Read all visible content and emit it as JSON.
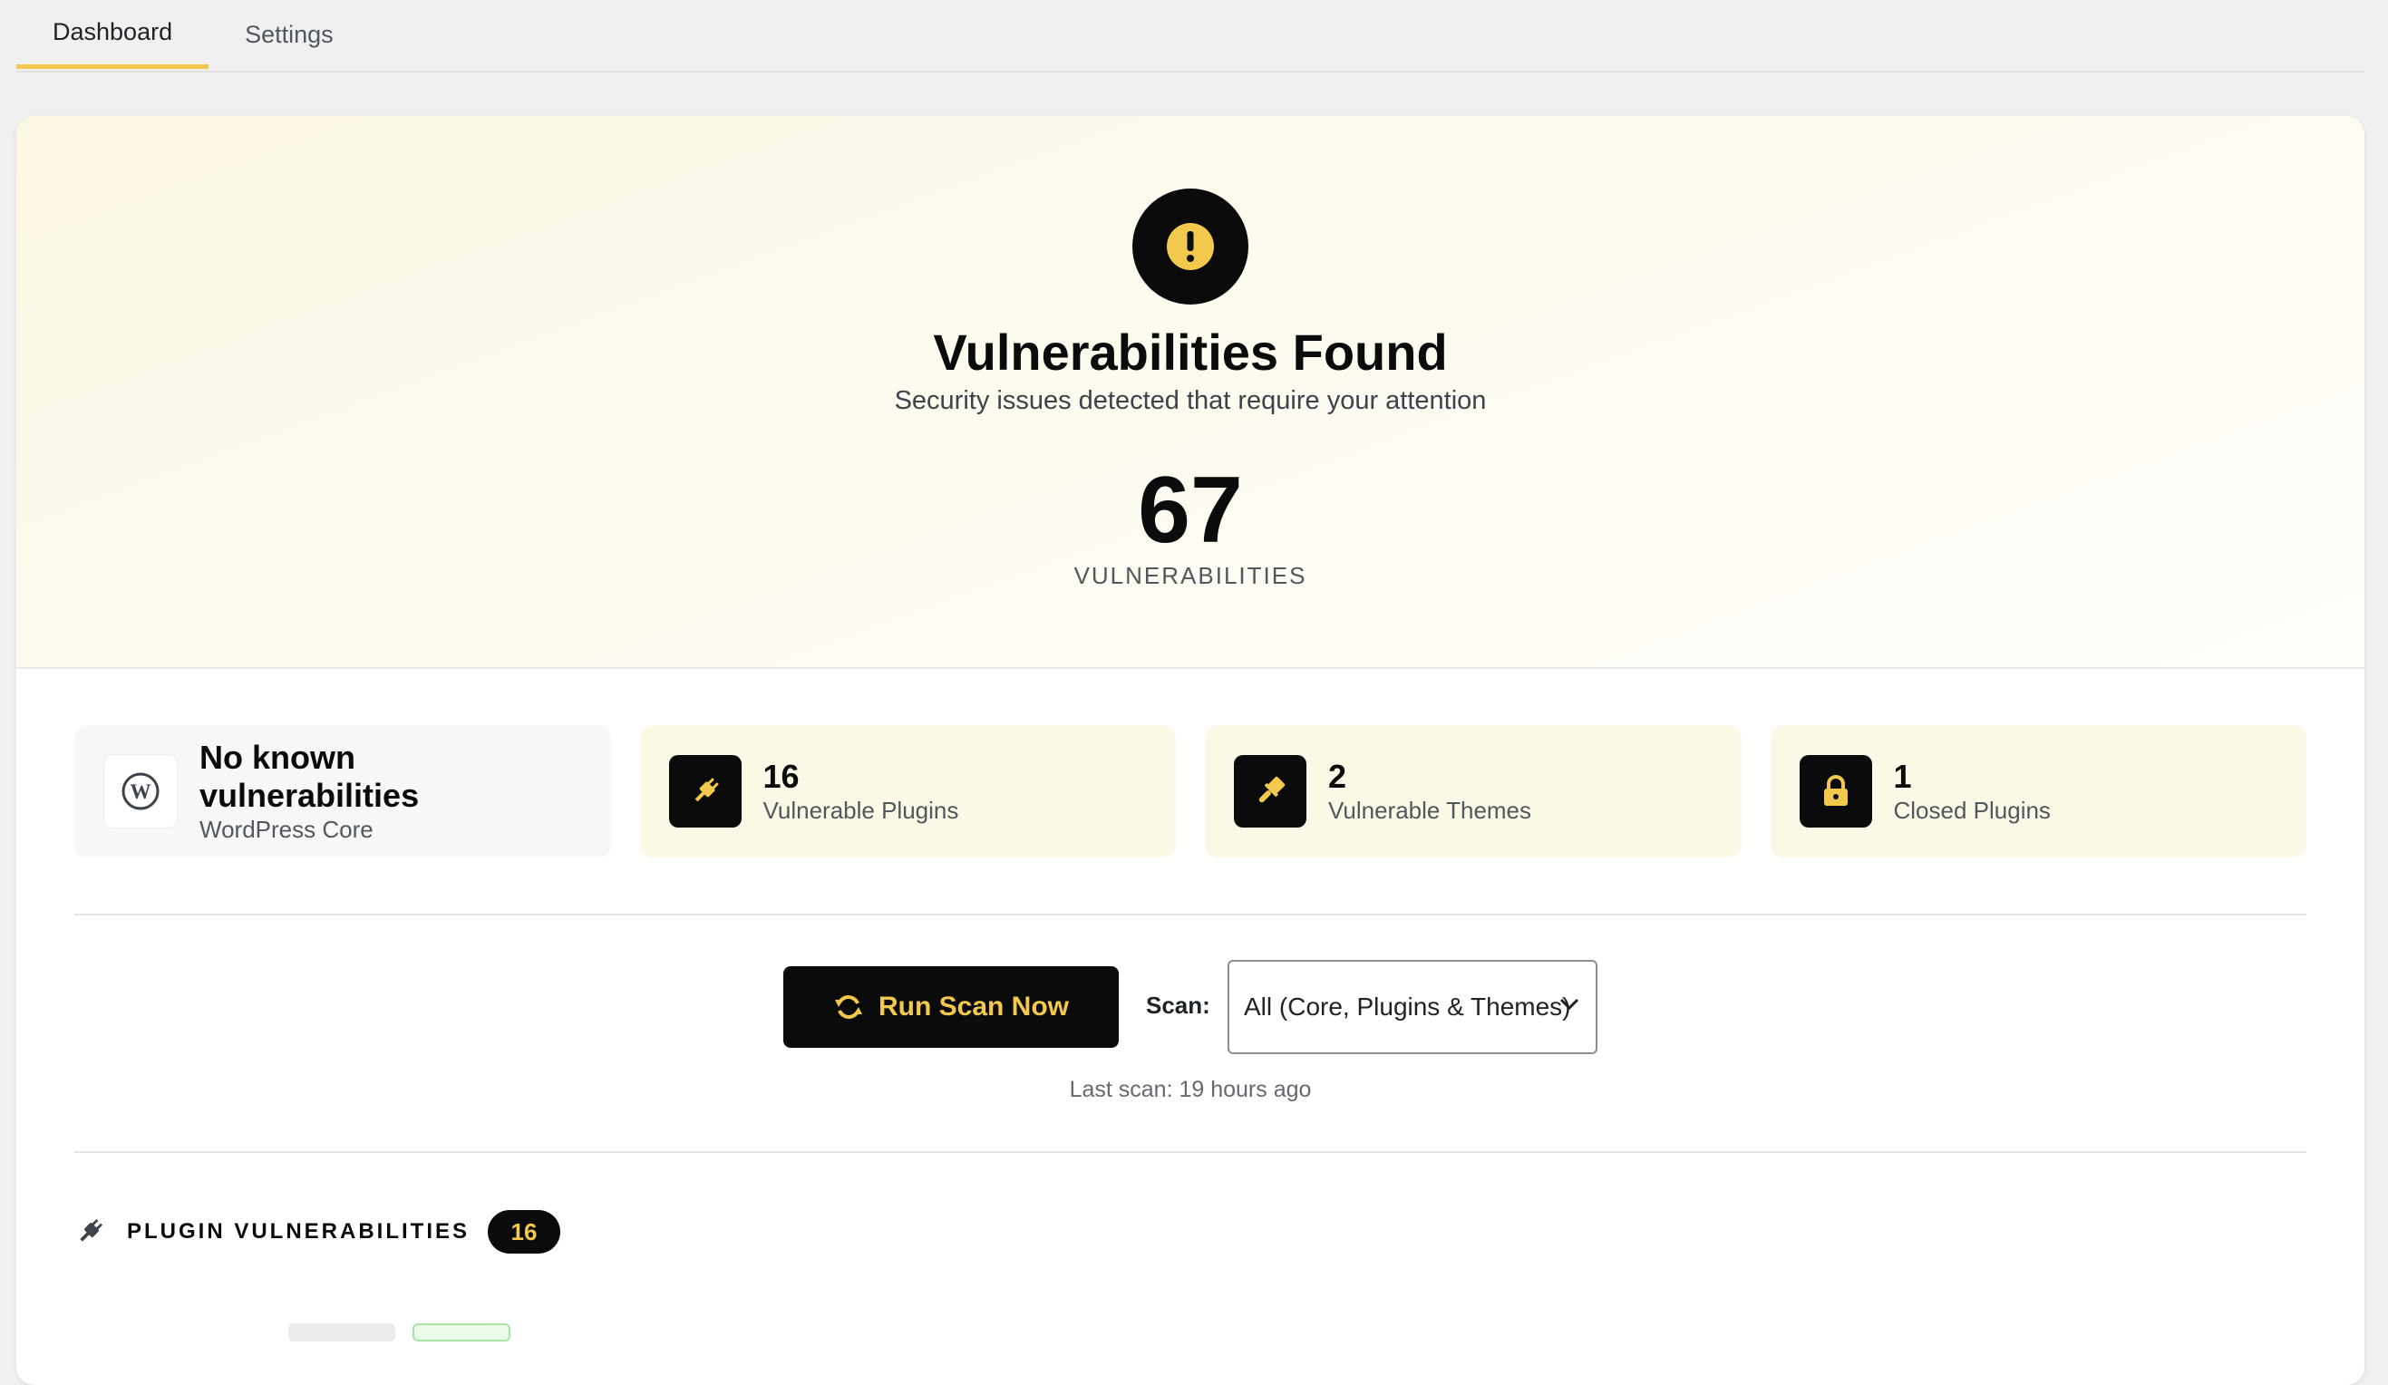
{
  "tabs": [
    {
      "label": "Dashboard",
      "active": true
    },
    {
      "label": "Settings",
      "active": false
    }
  ],
  "hero": {
    "icon": "exclamation-icon",
    "title": "Vulnerabilities Found",
    "subtitle": "Security issues detected that require your attention",
    "count": "67",
    "count_label": "VULNERABILITIES"
  },
  "stats": [
    {
      "icon": "wordpress-icon",
      "value": "No known vulnerabilities",
      "label": "WordPress Core"
    },
    {
      "icon": "plug-icon",
      "value": "16",
      "label": "Vulnerable Plugins"
    },
    {
      "icon": "paintbrush-icon",
      "value": "2",
      "label": "Vulnerable Themes"
    },
    {
      "icon": "lock-icon",
      "value": "1",
      "label": "Closed Plugins"
    }
  ],
  "scan": {
    "button_label": "Run Scan Now",
    "button_icon": "refresh-icon",
    "select_label": "Scan:",
    "select_value": "All (Core, Plugins & Themes)",
    "last_scan": "Last scan: 19 hours ago"
  },
  "section": {
    "icon": "plug-icon",
    "title": "PLUGIN VULNERABILITIES",
    "count": "16"
  },
  "colors": {
    "accent": "#f2c94c",
    "dark": "#0b0b0b",
    "hero_bg": "#fcf7e3",
    "card_bg": "#fcf8e6"
  }
}
